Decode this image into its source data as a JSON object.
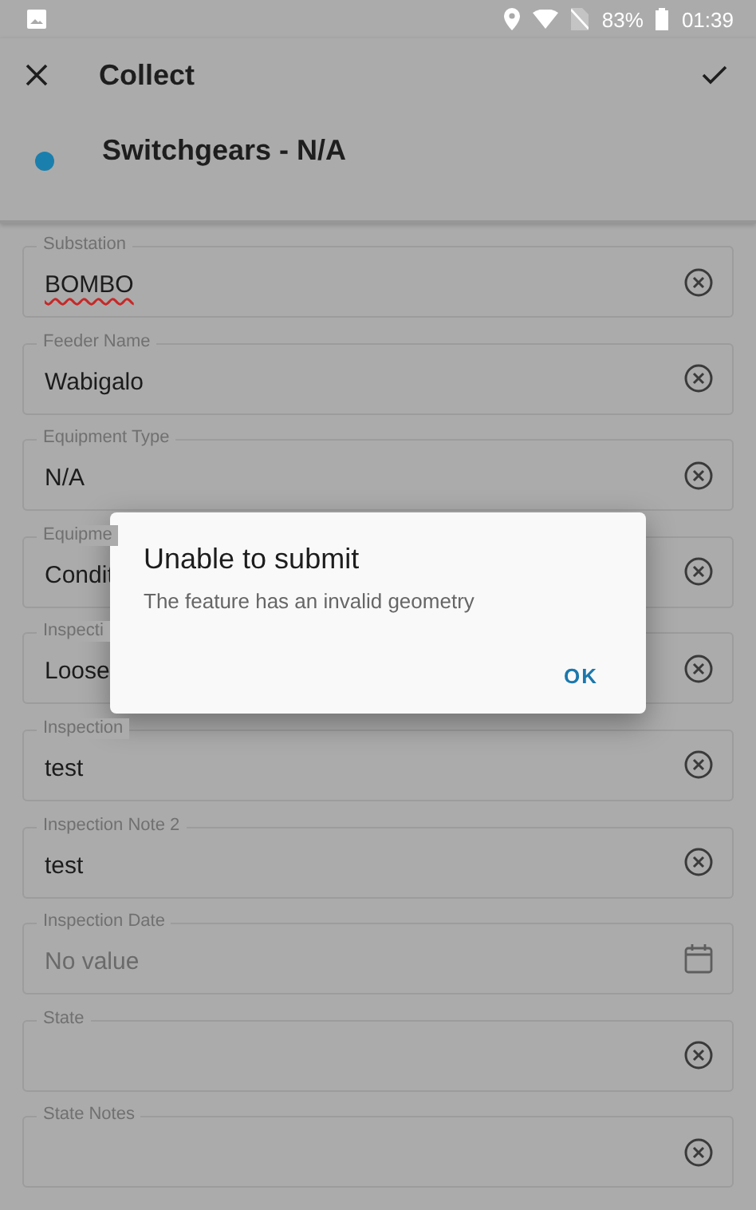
{
  "status_bar": {
    "battery": "83%",
    "time": "01:39"
  },
  "toolbar": {
    "title": "Collect"
  },
  "feature": {
    "title": "Switchgears - N/A",
    "color": "#1a7fad"
  },
  "fields": [
    {
      "kind": "text",
      "label": "Substation",
      "value": "BOMBO",
      "misspelled": true
    },
    {
      "kind": "text",
      "label": "Feeder Name",
      "value": "Wabigalo",
      "misspelled": false
    },
    {
      "kind": "text",
      "label": "Equipment Type",
      "value": "N/A",
      "misspelled": false
    },
    {
      "kind": "text",
      "label": "Equipme",
      "value": "Condit",
      "misspelled": false
    },
    {
      "kind": "text",
      "label": "Inspecti",
      "value": "Loose",
      "misspelled": false
    },
    {
      "kind": "text",
      "label": "Inspection",
      "value": "test",
      "misspelled": false
    },
    {
      "kind": "text",
      "label": "Inspection Note 2",
      "value": "test",
      "misspelled": false
    },
    {
      "kind": "date",
      "label": "Inspection Date",
      "placeholder": "No value"
    },
    {
      "kind": "text",
      "label": "State"
    },
    {
      "kind": "text",
      "label": "State Notes"
    }
  ],
  "dialog": {
    "title": "Unable to submit",
    "message": "The feature has an invalid geometry",
    "buttons": [
      "OK"
    ]
  }
}
